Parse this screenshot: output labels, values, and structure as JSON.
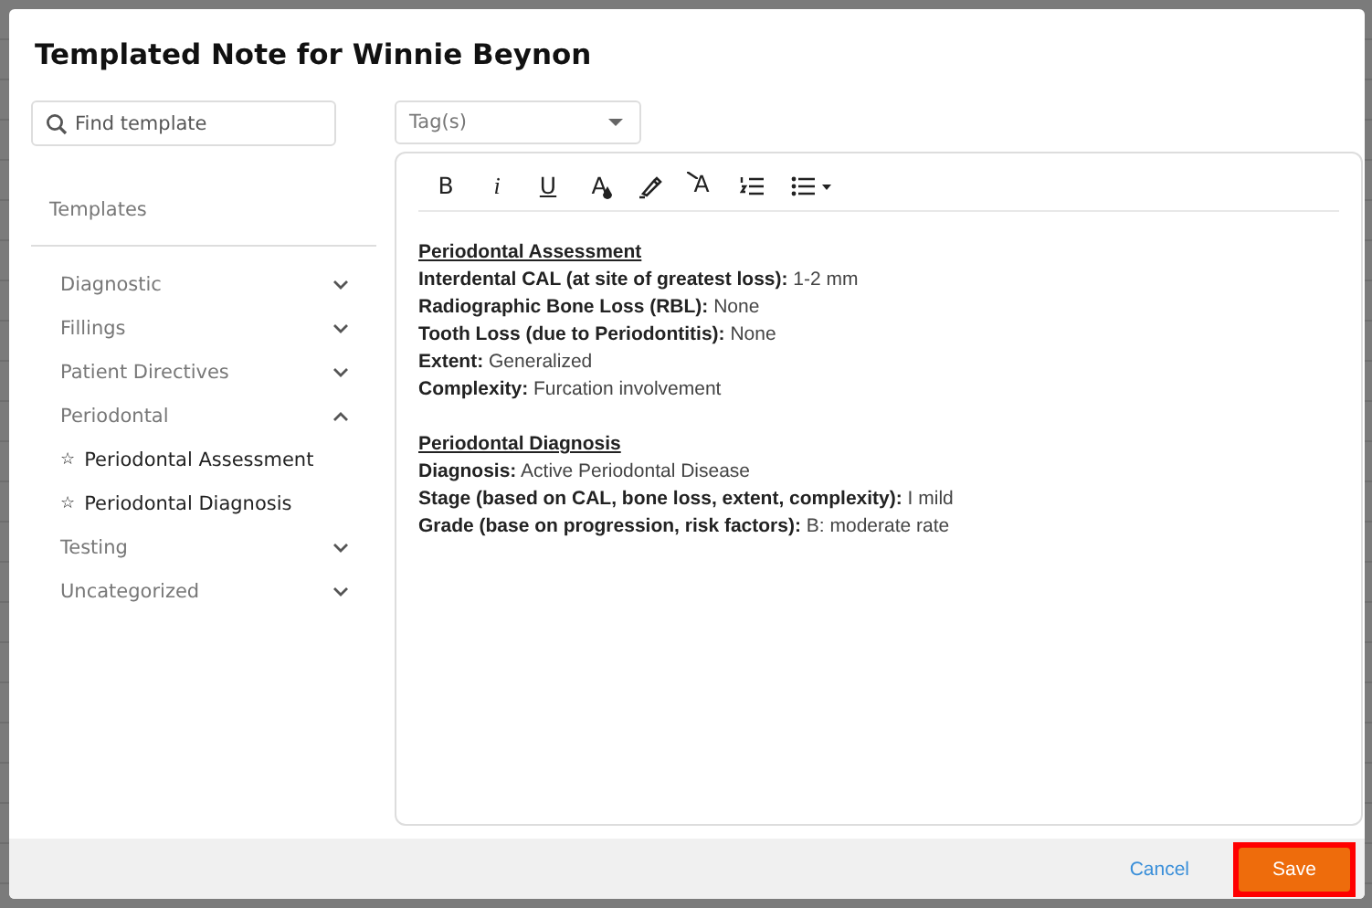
{
  "dialog": {
    "title": "Templated Note for Winnie Beynon"
  },
  "search": {
    "placeholder": "Find template"
  },
  "templates_label": "Templates",
  "categories": [
    {
      "label": "Diagnostic",
      "expanded": false
    },
    {
      "label": "Fillings",
      "expanded": false
    },
    {
      "label": "Patient Directives",
      "expanded": false
    },
    {
      "label": "Periodontal",
      "expanded": true,
      "children": [
        {
          "label": "Periodontal Assessment",
          "icon": "☆"
        },
        {
          "label": "Periodontal Diagnosis",
          "icon": "☆"
        }
      ]
    },
    {
      "label": "Testing",
      "expanded": false
    },
    {
      "label": "Uncategorized",
      "expanded": false
    }
  ],
  "tags": {
    "placeholder": "Tag(s)"
  },
  "toolbar": [
    {
      "kind": "bold",
      "label": "B"
    },
    {
      "kind": "italic",
      "label": "i"
    },
    {
      "kind": "underline",
      "label": "U"
    },
    {
      "kind": "text-color",
      "label": "A"
    },
    {
      "kind": "highlight"
    },
    {
      "kind": "clear-format",
      "label": "A"
    },
    {
      "kind": "ordered-list"
    },
    {
      "kind": "bullet-list"
    }
  ],
  "note": [
    {
      "heading": "Periodontal Assessment",
      "lines": [
        "**Interdental CAL (at site of greatest loss):** 1-2 mm",
        "**Radiographic Bone Loss (RBL):** None",
        "**Tooth Loss (due to Periodontitis):** None",
        "**Extent:** Generalized",
        "**Complexity:** Furcation involvement"
      ]
    },
    {
      "heading": "Periodontal Diagnosis",
      "lines": [
        "**Diagnosis:** Active Periodontal Disease",
        "**Stage (based on CAL, bone loss, extent, complexity):** I mild",
        "**Grade (base on progression, risk factors):** B: moderate rate"
      ]
    }
  ],
  "footer": {
    "cancel": "Cancel",
    "save": "Save",
    "save_highlighted": true
  }
}
